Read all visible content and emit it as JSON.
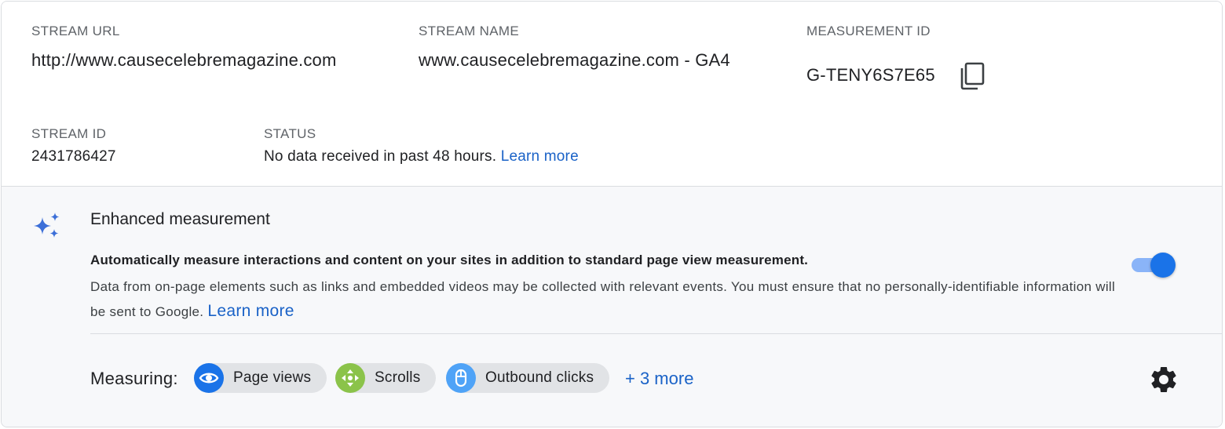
{
  "stream": {
    "url_label": "STREAM URL",
    "url_value": "http://www.causecelebremagazine.com",
    "name_label": "STREAM NAME",
    "name_value": "www.causecelebremagazine.com - GA4",
    "measurement_label": "MEASUREMENT ID",
    "measurement_value": "G-TENY6S7E65",
    "id_label": "STREAM ID",
    "id_value": "2431786427",
    "status_label": "STATUS",
    "status_value": "No data received in past 48 hours.",
    "status_link": "Learn more"
  },
  "enhanced": {
    "title": "Enhanced measurement",
    "bold_text": "Automatically measure interactions and content on your sites in addition to standard page view measurement.",
    "desc_text": "Data from on-page elements such as links and embedded videos may be collected with relevant events. You must ensure that no personally-identifiable information will be sent to Google.",
    "desc_link": "Learn more",
    "toggle_on": true,
    "measuring_label": "Measuring:",
    "chips": [
      {
        "label": "Page views",
        "icon": "eye-icon",
        "color": "#1a73e8"
      },
      {
        "label": "Scrolls",
        "icon": "scroll-arrows-icon",
        "color": "#8bc34a"
      },
      {
        "label": "Outbound clicks",
        "icon": "mouse-icon",
        "color": "#4fa3f7"
      }
    ],
    "more_label": "+ 3 more"
  },
  "colors": {
    "accent": "#1a73e8",
    "link": "#1a62c7"
  }
}
